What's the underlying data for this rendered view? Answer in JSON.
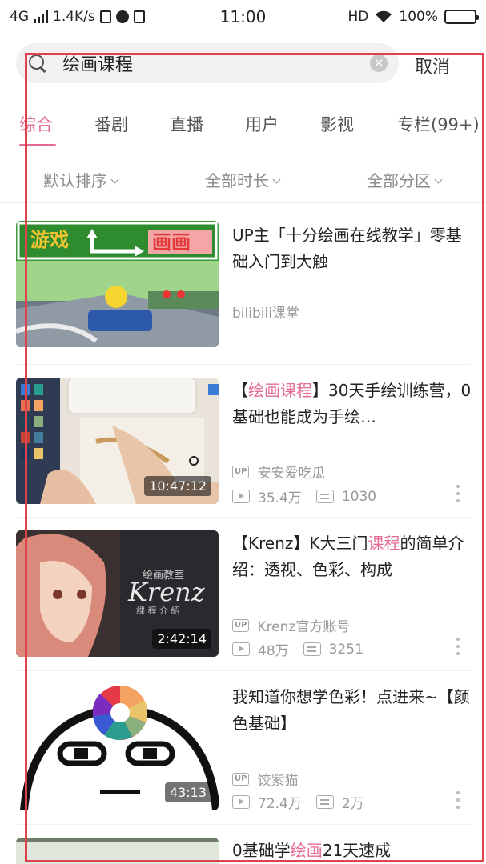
{
  "status_bar": {
    "network": "4G",
    "speed": "1.4K/s",
    "time": "11:00",
    "hd": "HD",
    "battery": "100%",
    "battery_level": 1.0
  },
  "search": {
    "query": "绘画课程",
    "placeholder": "",
    "cancel_label": "取消"
  },
  "tabs": [
    {
      "label": "综合",
      "active": true
    },
    {
      "label": "番剧"
    },
    {
      "label": "直播"
    },
    {
      "label": "用户"
    },
    {
      "label": "影视"
    },
    {
      "label": "专栏(99+)"
    }
  ],
  "filters": {
    "sort": "默认排序",
    "duration": "全部时长",
    "zone": "全部分区"
  },
  "videos": [
    {
      "title_parts": [
        "UP主「十分绘画在线教学」零基础入门到大触"
      ],
      "uploader": "bilibili课堂",
      "has_stats": false
    },
    {
      "title_pre": "【",
      "title_hl": "绘画课程",
      "title_post": "】30天手绘训练营，0基础也能成为手绘…",
      "duration": "10:47:12",
      "uploader": "安安爱吃瓜",
      "views": "35.4万",
      "danmaku": "1030"
    },
    {
      "title_pre": "【Krenz】K大三门",
      "title_hl": "课程",
      "title_post": "的简单介绍：透视、色彩、构成",
      "duration": "2:42:14",
      "uploader": "Krenz官方账号",
      "views": "48万",
      "danmaku": "3251"
    },
    {
      "title_parts": [
        "我知道你想学色彩！点进来~【颜色基础】"
      ],
      "duration": "43:13",
      "uploader": "饺紫猫",
      "views": "72.4万",
      "danmaku": "2万"
    },
    {
      "title_pre": "0基础学",
      "title_hl": "绘画",
      "title_post": "21天速成"
    }
  ],
  "thumb_text": {
    "v1_left": "游戏",
    "v1_right": "画画",
    "v3_brand": "Krenz",
    "v3_small": "绘画教室",
    "v3_sub": "課 程 介 紹"
  },
  "labels": {
    "up_badge": "UP"
  },
  "colors": {
    "accent": "#e46b92",
    "frame": "#e0424d"
  }
}
